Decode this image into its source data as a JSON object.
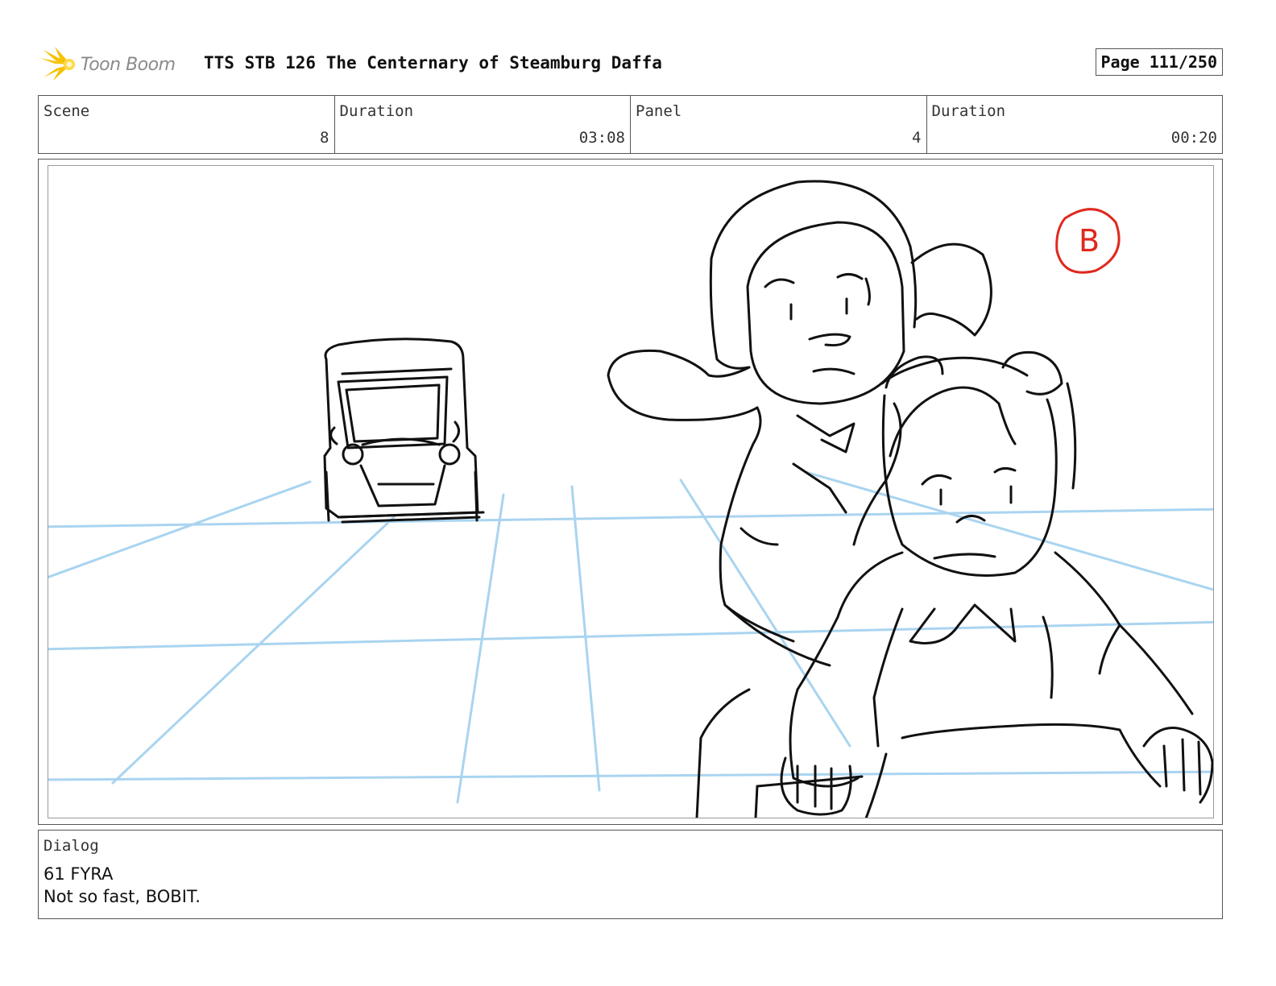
{
  "header": {
    "logo_text": "Toon Boom",
    "title": "TTS STB 126 The Centernary of Steamburg Daffa",
    "page": "Page 111/250"
  },
  "info": {
    "scene_label": "Scene",
    "scene_value": "8",
    "scene_duration_label": "Duration",
    "scene_duration_value": "03:08",
    "panel_label": "Panel",
    "panel_value": "4",
    "panel_duration_label": "Duration",
    "panel_duration_value": "00:20"
  },
  "panel": {
    "marker": "B",
    "colors": {
      "sketch": "#111111",
      "guides": "#a9d4f0",
      "marker": "#e0281e"
    }
  },
  "dialog": {
    "label": "Dialog",
    "lines": [
      "61 FYRA",
      "Not so fast, BOBIT."
    ]
  }
}
